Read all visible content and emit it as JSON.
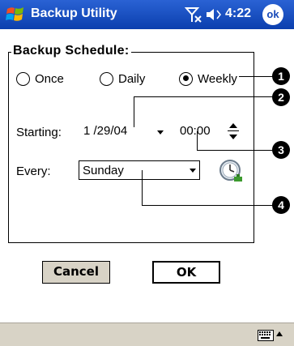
{
  "titlebar": {
    "title": "Backup Utility",
    "time": "4:22",
    "ok_label": "ok",
    "start_icon": "windows-flag-icon",
    "signal_icon": "no-signal-icon",
    "volume_icon": "volume-icon"
  },
  "schedule": {
    "group_title": "Backup Schedule:",
    "frequency_options": [
      {
        "label": "Once",
        "selected": false
      },
      {
        "label": "Daily",
        "selected": false
      },
      {
        "label": "Weekly",
        "selected": true
      }
    ],
    "starting_label": "Starting:",
    "start_date": "1 /29/04",
    "start_time": "00:00",
    "every_label": "Every:",
    "every_value": "Sunday",
    "schedule_icon": "clock-icon"
  },
  "callouts": [
    "1",
    "2",
    "3",
    "4"
  ],
  "buttons": {
    "cancel": "Cancel",
    "ok": "OK"
  },
  "bottombar": {
    "keyboard_icon": "keyboard-icon",
    "input_arrow_icon": "up-arrow-icon"
  },
  "colors": {
    "titlebar": "#1648b8",
    "button_face": "#d8d3c6",
    "bottombar": "#d8d3c6"
  }
}
